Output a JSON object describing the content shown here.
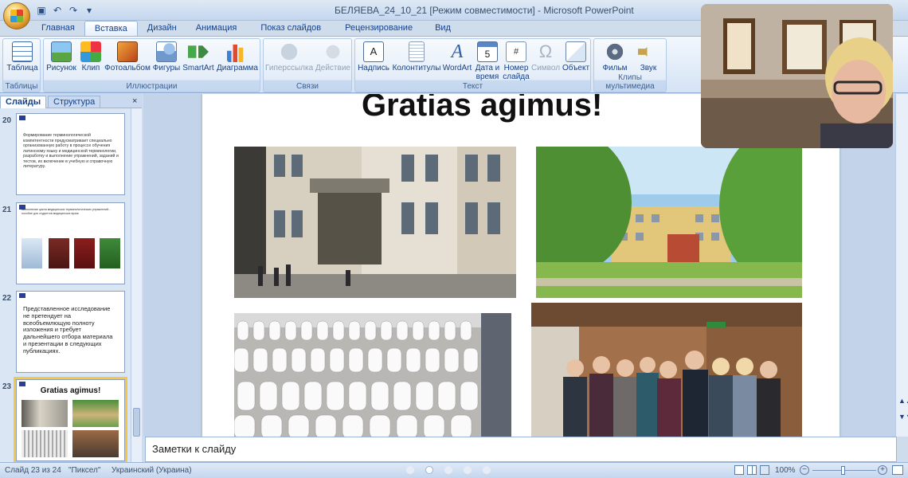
{
  "window": {
    "title": "БЕЛЯЕВА_24_10_21 [Режим совместимости] - Microsoft PowerPoint"
  },
  "ribbon_tabs": [
    {
      "label": "Главная"
    },
    {
      "label": "Вставка"
    },
    {
      "label": "Дизайн"
    },
    {
      "label": "Анимация"
    },
    {
      "label": "Показ слайдов"
    },
    {
      "label": "Рецензирование"
    },
    {
      "label": "Вид"
    }
  ],
  "ribbon": {
    "groups": {
      "tables": "Таблицы",
      "illustrations": "Иллюстрации",
      "links": "Связи",
      "text": "Текст",
      "media": "Клипы мультимедиа"
    },
    "buttons": {
      "table": "Таблица",
      "picture": "Рисунок",
      "clip": "Клип",
      "photo_album": "Фотоальбом",
      "shapes": "Фигуры",
      "smartart": "SmartArt",
      "chart": "Диаграмма",
      "hyperlink": "Гиперссылка",
      "action": "Действие",
      "textbox": "Надпись",
      "header_footer": "Колонтитулы",
      "wordart": "WordArt",
      "datetime_1": "Дата и",
      "datetime_2": "время",
      "slide_number_1": "Номер",
      "slide_number_2": "слайда",
      "symbol": "Символ",
      "object": "Объект",
      "movie": "Фильм",
      "sound": "Звук"
    }
  },
  "left_panel": {
    "tabs": {
      "slides": "Слайды",
      "outline": "Структура"
    },
    "thumbnails": [
      {
        "number": "20",
        "text": "Формирование терминологической компетентности предусматривает специально организованную работу в процессе обучения латинскому языку и медицинской терминологии, разработку и выполнение упражнений, заданий и тестов, их включение в учебную и справочную литературу."
      },
      {
        "number": "21",
        "text": "Выполнение цикла медицинских терминологических упражнений… пособие для студентов медицинских вузов."
      },
      {
        "number": "22",
        "text": "Представленное исследование не претендует на всеобъемлющую полноту изложения и требует дальнейшего отбора материала и презентации в следующих публикациях."
      },
      {
        "number": "23",
        "text": "Gratias agimus!"
      }
    ]
  },
  "slide": {
    "title": "Gratias agimus!"
  },
  "notes": {
    "placeholder": "Заметки к слайду"
  },
  "status_bar": {
    "slide_info": "Слайд 23 из 24",
    "theme": "\"Пиксел\"",
    "language": "Украинский (Украина)",
    "zoom": "100%"
  },
  "colors": {
    "ribbon_bg": "#dbe7f6",
    "accent_selected": "#f6c648",
    "text_blue": "#15428b"
  }
}
